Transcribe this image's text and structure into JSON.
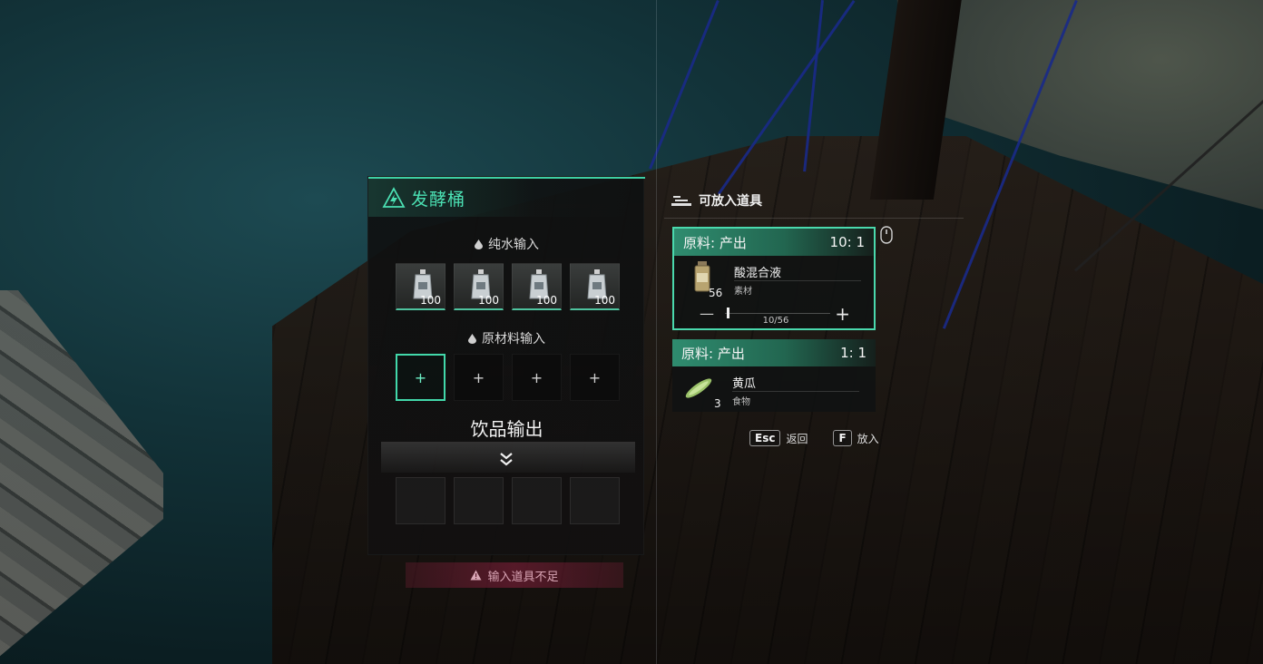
{
  "machine": {
    "title": "发酵桶",
    "water_input_label": "纯水输入",
    "water_slots": [
      {
        "qty": "100"
      },
      {
        "qty": "100"
      },
      {
        "qty": "100"
      },
      {
        "qty": "100"
      }
    ],
    "material_input_label": "原材料输入",
    "material_slots": [
      "+",
      "+",
      "+",
      "+"
    ],
    "output_label": "饮品输出",
    "warning": "输入道具不足"
  },
  "items_panel": {
    "title": "可放入道具",
    "recipes": [
      {
        "head_label": "原料: 产出",
        "ratio": "10: 1",
        "name": "酸混合液",
        "category": "素材",
        "count": "56",
        "stepper_value": "10/56",
        "stepper_fraction": 0.18,
        "selected": true
      },
      {
        "head_label": "原料: 产出",
        "ratio": "1: 1",
        "name": "黄瓜",
        "category": "食物",
        "count": "3",
        "selected": false
      }
    ]
  },
  "key_hints": {
    "back_key": "Esc",
    "back_label": "返回",
    "place_key": "F",
    "place_label": "放入"
  },
  "colors": {
    "accent": "#4be0b3",
    "warning": "#7a2040"
  }
}
